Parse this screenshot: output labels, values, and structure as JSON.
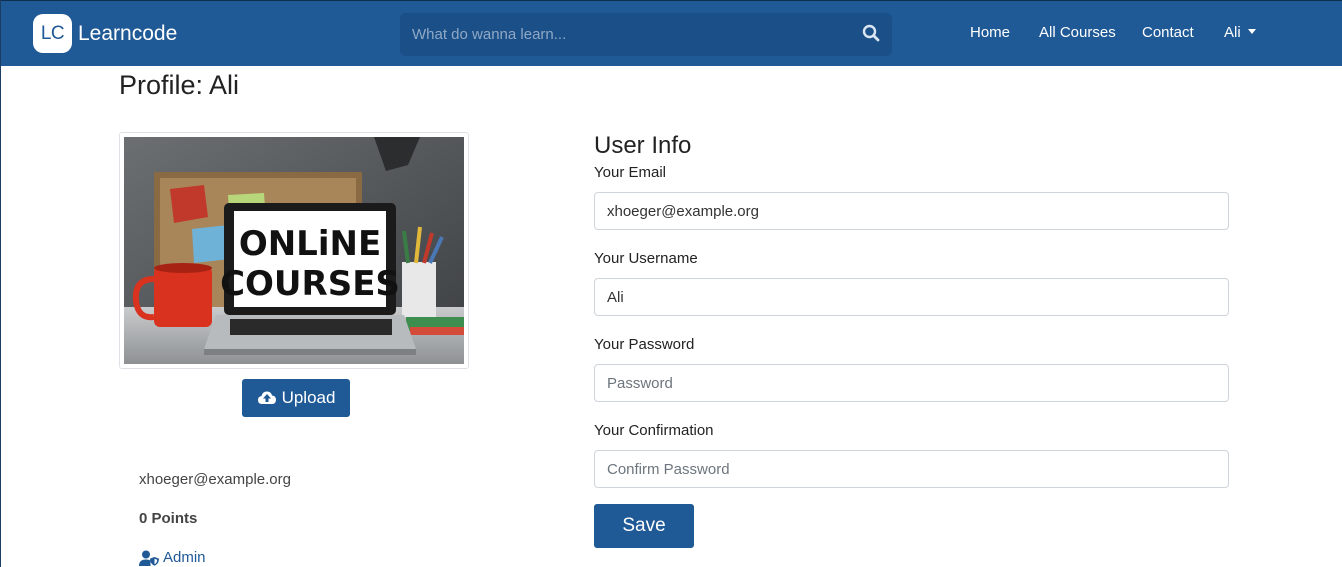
{
  "brand": {
    "logo_text": "LC",
    "name": "Learncode"
  },
  "search": {
    "placeholder": "What do wanna learn..."
  },
  "nav": {
    "home": "Home",
    "courses": "All Courses",
    "contact": "Contact",
    "user": "Ali"
  },
  "page": {
    "title": "Profile: Ali"
  },
  "profile_image": {
    "screen_line1": "ONLiNE",
    "screen_line2": "COURSES"
  },
  "upload": {
    "label": "Upload"
  },
  "user_summary": {
    "email": "xhoeger@example.org",
    "points": "0 Points",
    "role": "Admin"
  },
  "form": {
    "title": "User Info",
    "email_label": "Your Email",
    "email_value": "xhoeger@example.org",
    "username_label": "Your Username",
    "username_value": "Ali",
    "password_label": "Your Password",
    "password_placeholder": "Password",
    "confirm_label": "Your Confirmation",
    "confirm_placeholder": "Confirm Password",
    "save_label": "Save"
  },
  "colors": {
    "primary": "#1f5996",
    "navbar": "#1f5996",
    "search_bg": "#1b4f88"
  }
}
